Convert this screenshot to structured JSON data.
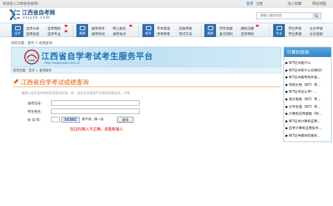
{
  "topbar": {
    "welcome": "欢迎进入江西省自考网！",
    "login": "登录",
    "register": "注册",
    "favorite": "加入收藏",
    "sitemap": "网站地图"
  },
  "logo": {
    "cn": "江西省自考网",
    "en": "zsjyzk.com"
  },
  "search": {
    "placeholder": "请输入搜索内容"
  },
  "nav": {
    "groups": [
      {
        "tile": "自考",
        "links": [
          "自考头条",
          "自考院校",
          "自考动态",
          "自考专业"
        ]
      },
      {
        "tile": "真题",
        "links": [
          "报考条件",
          "网上报名",
          "报考时间",
          "报考地点"
        ]
      },
      {
        "tile": "报考",
        "links": [
          "专本套读",
          "实践考核",
          "停考转考",
          "考试方法"
        ]
      },
      {
        "tile": "真题",
        "links": [
          "历年真题",
          "模拟试题",
          "复习资料",
          "自考网校"
        ]
      },
      {
        "tile": "毕业",
        "links": [
          "学位申请",
          "论文申请",
          "学位英语",
          "论文答辩"
        ]
      }
    ]
  },
  "breadcrumb1": "您的位置：首页 > 成绩查询",
  "banner": {
    "title": "江西省自学考试考生服务平台",
    "url": "http://www.jxzk.com.cn"
  },
  "breadcrumb2": "您的位置：首页 > 查询服务",
  "query": {
    "title": "江西省自学考试成绩查询",
    "hint": "请输入准考证号和姓名等查询信息，如：准考证号查询不全请您留意查询，引用",
    "id_label": "准考证号：",
    "name_label": "考生姓名：",
    "captcha_label": "验 证 码：",
    "captcha_text": "SV3GC",
    "refresh_text": "看不清，换一张",
    "submit": "查询",
    "error": "验证码输入不正确，请重新输入"
  },
  "sidebar": {
    "title": "计算机纸免",
    "items": [
      "NIT证书是什么",
      "NIT证书有什么作用吗?",
      "NIT证书报考条件是...",
      "项目文档（NIT）考...",
      "NIT证书怎么考？...",
      "电子表格（NIT）考...",
      "文字处理（NIT）考...",
      "计算机应用基础（NI...",
      "NIT证书计算机应用...",
      "自考计算机应用技术...",
      "NIT证书模块的基本..."
    ]
  },
  "colors": {
    "accent": "#2e6cae",
    "banner_title": "#1c6fb8",
    "query_title": "#e85a00",
    "error": "#e00000"
  }
}
